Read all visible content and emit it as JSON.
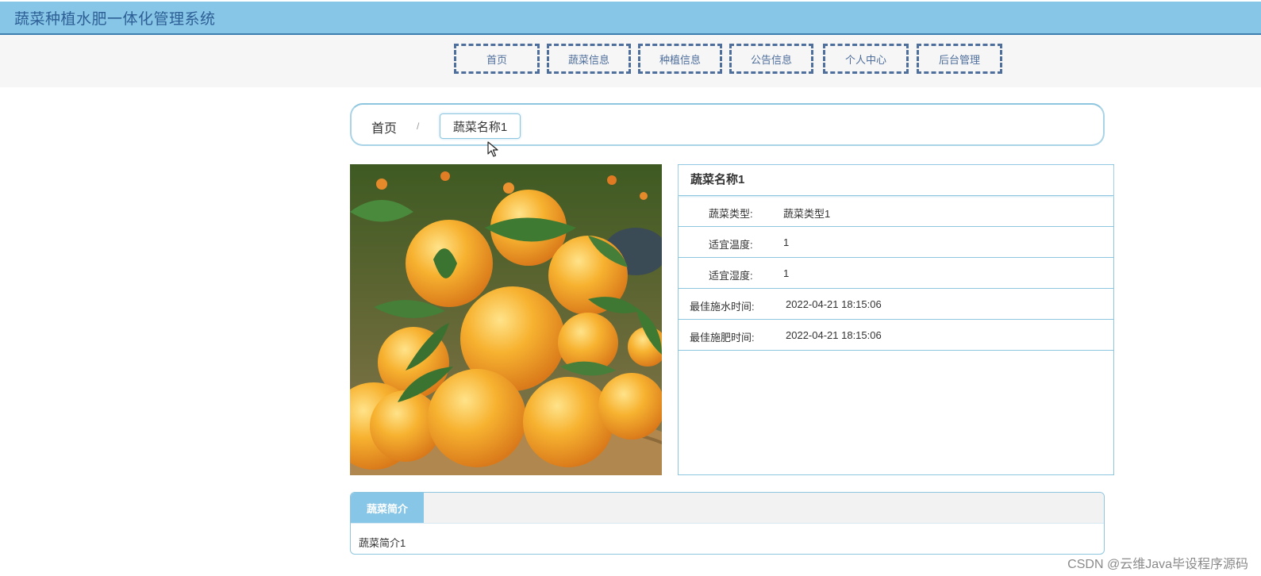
{
  "header": {
    "title": "蔬菜种植水肥一体化管理系统"
  },
  "nav": {
    "items": [
      {
        "label": "首页"
      },
      {
        "label": "蔬菜信息"
      },
      {
        "label": "种植信息"
      },
      {
        "label": "公告信息"
      },
      {
        "label": "个人中心"
      },
      {
        "label": "后台管理"
      }
    ]
  },
  "breadcrumb": {
    "home": "首页",
    "separator": "/",
    "current": "蔬菜名称1"
  },
  "detail": {
    "title": "蔬菜名称1",
    "rows": [
      {
        "label": "蔬菜类型:",
        "value": "蔬菜类型1"
      },
      {
        "label": "适宜温度:",
        "value": "1"
      },
      {
        "label": "适宜湿度:",
        "value": "1"
      },
      {
        "label": "最佳施水时间:",
        "value": "2022-04-21 18:15:06"
      },
      {
        "label": "最佳施肥时间:",
        "value": "2022-04-21 18:15:06"
      }
    ]
  },
  "intro": {
    "tab": "蔬菜简介",
    "content": "蔬菜简介1"
  },
  "watermark": "CSDN @云维Java毕设程序源码",
  "colors": {
    "header_bg": "#87c6e6",
    "title_text": "#2d5f96",
    "nav_border": "#4e6e9b",
    "panel_border": "#8ec6e0"
  },
  "icons": {
    "cursor": "mouse-pointer-icon",
    "image": "oranges-photo"
  }
}
